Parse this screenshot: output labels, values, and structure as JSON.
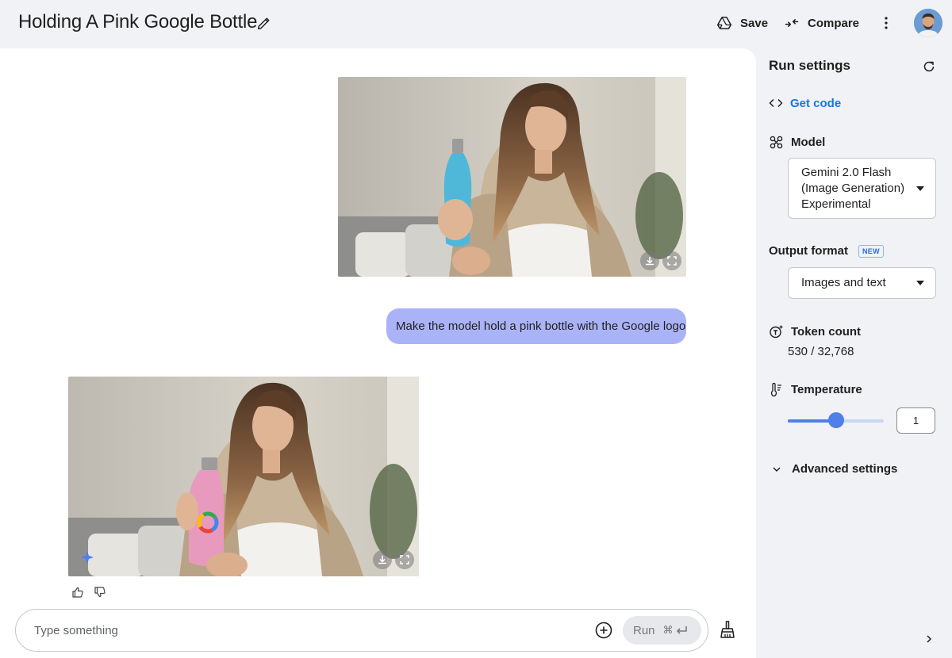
{
  "header": {
    "title": "Holding A Pink Google Bottle",
    "save_label": "Save",
    "compare_label": "Compare"
  },
  "chat": {
    "user_message": "Make the model hold a pink bottle with the Google logo",
    "input_placeholder": "Type something",
    "run_label": "Run",
    "run_shortcut": "⌘",
    "response_image_bottle_color": "#e79abd",
    "prompt_image_bottle_color": "#4fb8d9"
  },
  "settings": {
    "title": "Run settings",
    "get_code_label": "Get code",
    "model_label": "Model",
    "model_value_line1": "Gemini 2.0 Flash",
    "model_value_line2": "(Image Generation)",
    "model_value_line3": "Experimental",
    "output_format_label": "Output format",
    "output_format_badge": "NEW",
    "output_format_value": "Images and text",
    "token_count_label": "Token count",
    "token_count_value": "530 / 32,768",
    "temperature_label": "Temperature",
    "temperature_value": "1",
    "temperature_fraction": 0.5,
    "advanced_label": "Advanced settings"
  },
  "colors": {
    "accent": "#1a73e8",
    "user_bubble": "#aab3f7",
    "slider": "#4f7fe8"
  }
}
